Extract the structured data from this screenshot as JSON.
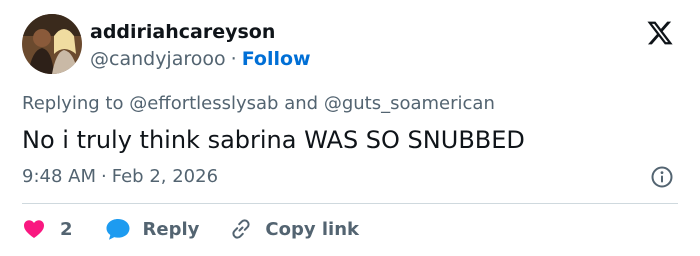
{
  "author": {
    "display_name": "addiriahcareyson",
    "handle": "@candyjarooo",
    "follow_label": "Follow"
  },
  "reply_context": {
    "prefix": "Replying to",
    "mention_1": "@effortlesslysab",
    "conjunction": "and",
    "mention_2": "@guts_soamerican"
  },
  "tweet": {
    "text": "No i truly think sabrina WAS SO SNUBBED",
    "time": "9:48 AM",
    "date": "Feb 2, 2026"
  },
  "actions": {
    "like_count": "2",
    "reply_label": "Reply",
    "copy_link_label": "Copy link"
  },
  "icons": {
    "brand": "x-logo-icon",
    "info": "info-icon",
    "like": "heart-icon",
    "reply": "speech-bubble-icon",
    "copy": "link-icon"
  },
  "colors": {
    "text": "#0f1419",
    "secondary": "#536471",
    "link": "#006fd6",
    "like": "#f91880",
    "reply": "#1d9bf0",
    "divider": "#cfd9de"
  }
}
